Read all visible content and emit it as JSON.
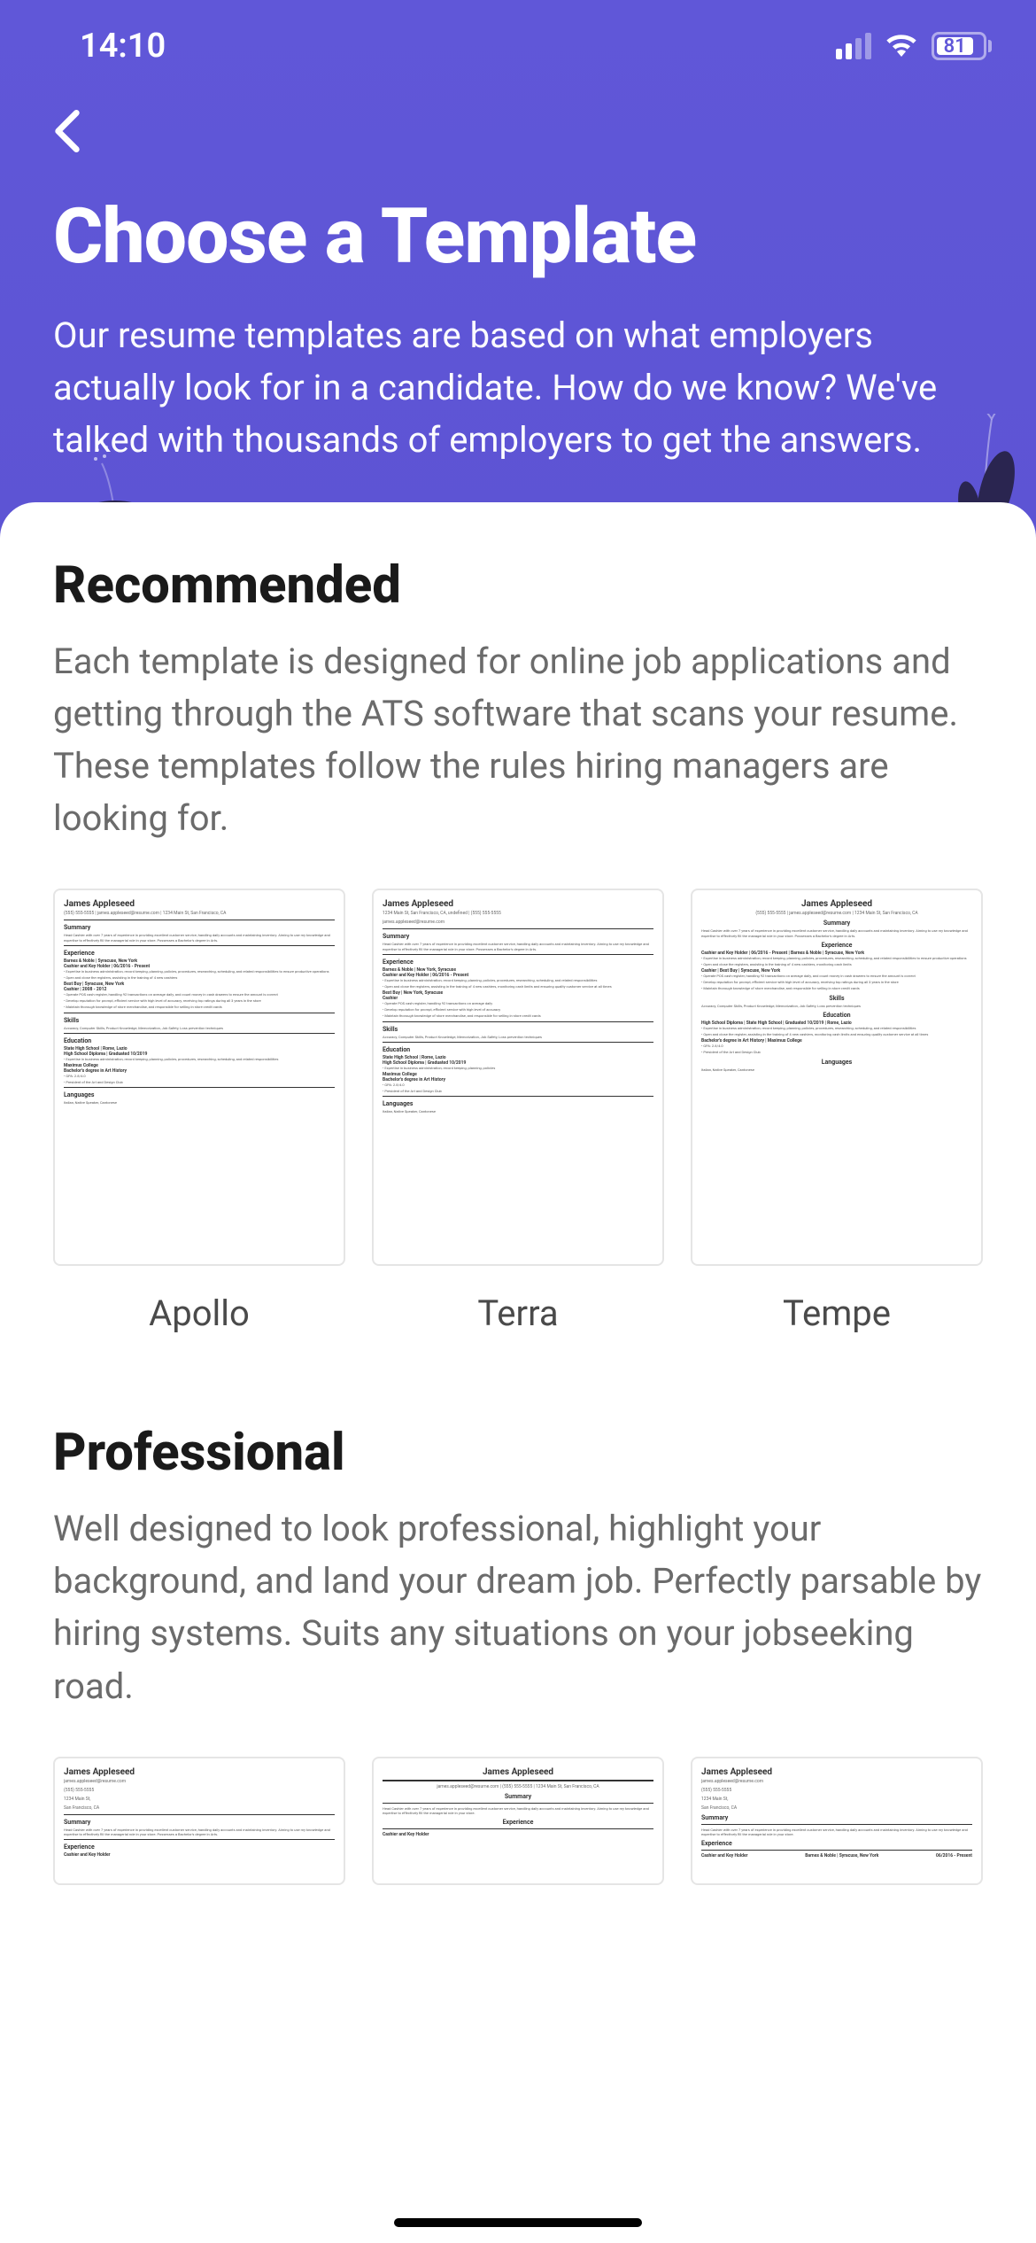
{
  "status": {
    "time": "14:10",
    "battery_percent": "81"
  },
  "header": {
    "title": "Choose a Template",
    "subtitle": "Our resume templates are based on what employers actually look for in a candidate. How do we know? We've talked with thousands of employers to get the answers."
  },
  "sections": [
    {
      "title": "Recommended",
      "description": "Each template is designed for online job applications and getting through the ATS software that scans your resume. These templates follow the rules hiring managers are looking for.",
      "templates": [
        {
          "name": "Apollo"
        },
        {
          "name": "Terra"
        },
        {
          "name": "Tempe"
        }
      ]
    },
    {
      "title": "Professional",
      "description": "Well designed to look professional, highlight your background, and land your dream job. Perfectly parsable by hiring systems. Suits any situations on your jobseeking road.",
      "templates": [
        {
          "name": ""
        },
        {
          "name": ""
        },
        {
          "name": ""
        }
      ]
    }
  ],
  "resume_sample": {
    "name": "James Appleseed",
    "contact": "(555) 555-5555 | james.appleseed@resume.com | 1234 Main St, San Francisco, CA",
    "summary_header": "Summary",
    "summary_text": "Head Cashier with over 7 years of experience in providing excellent customer service, handling daily accounts and maintaining inventory. Aiming to use my knowledge and expertise to effectively fill the managerial role in your store. Possesses a Bachelor's degree in Arts.",
    "experience_header": "Experience",
    "job1_company": "Barnes & Noble | Syracuse, New York",
    "job1_title": "Cashier and Key Holder | 06/2016 - Present",
    "job2_company": "Best Buy | Syracuse, New York",
    "job2_title": "Cashier | 2008 - 2012",
    "skills_header": "Skills",
    "skills_text": "Accuracy, Computer Skills, Product Knowledge, Memorization, Job Safety, Loss prevention techniques",
    "education_header": "Education",
    "edu1": "State High School | Rome, Lazio",
    "edu2": "High School Diploma | Graduated 10/2019",
    "edu3": "Maximus College",
    "edu4": "Bachelor's degree in Art History",
    "languages_header": "Languages",
    "languages_text": "Italian, Native Speaker, Cantonese"
  }
}
